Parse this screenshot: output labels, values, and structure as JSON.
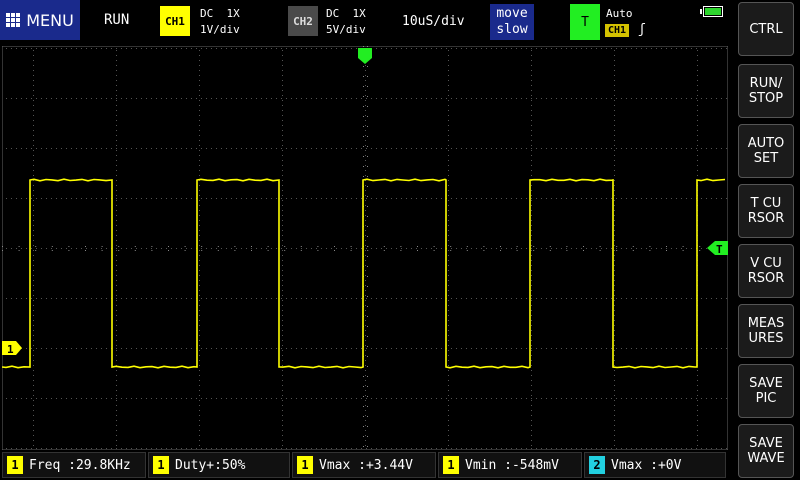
{
  "topbar": {
    "menu_label": "MENU",
    "run_status": "RUN",
    "ch1": {
      "tag": "CH1",
      "coupling": "DC  1X",
      "scale": "1V/div"
    },
    "ch2": {
      "tag": "CH2",
      "coupling": "DC  1X",
      "scale": "5V/div"
    },
    "timebase": "10uS/div",
    "move": {
      "line1": "move",
      "line2": "slow"
    },
    "trigger": {
      "tag": "T",
      "mode": "Auto",
      "source": "CH1",
      "edge": "ʃ"
    }
  },
  "side_buttons": [
    {
      "label": "CTRL"
    },
    {
      "label": "RUN/\nSTOP"
    },
    {
      "label": "AUTO\nSET"
    },
    {
      "label": "T CU\nRSOR"
    },
    {
      "label": "V CU\nRSOR"
    },
    {
      "label": "MEAS\nURES"
    },
    {
      "label": "SAVE\nPIC"
    },
    {
      "label": "SAVE\nWAVE"
    }
  ],
  "markers": {
    "ch1_marker": "1",
    "trigger_level_marker": "T"
  },
  "measurements": [
    {
      "channel": "1",
      "label": "Freq :",
      "value": "29.8KHz"
    },
    {
      "channel": "1",
      "label": "Duty+:",
      "value": "50%"
    },
    {
      "channel": "1",
      "label": "Vmax :",
      "value": "+3.44V"
    },
    {
      "channel": "1",
      "label": "Vmin :",
      "value": "-548mV"
    },
    {
      "channel": "2",
      "label": "Vmax :",
      "value": "+0V"
    }
  ],
  "colors": {
    "ch1": "#ffff00",
    "ch2": "#22d0e0",
    "trigger": "#22ee22",
    "menu_bg": "#1a2a8c",
    "grid": "#666666"
  }
}
